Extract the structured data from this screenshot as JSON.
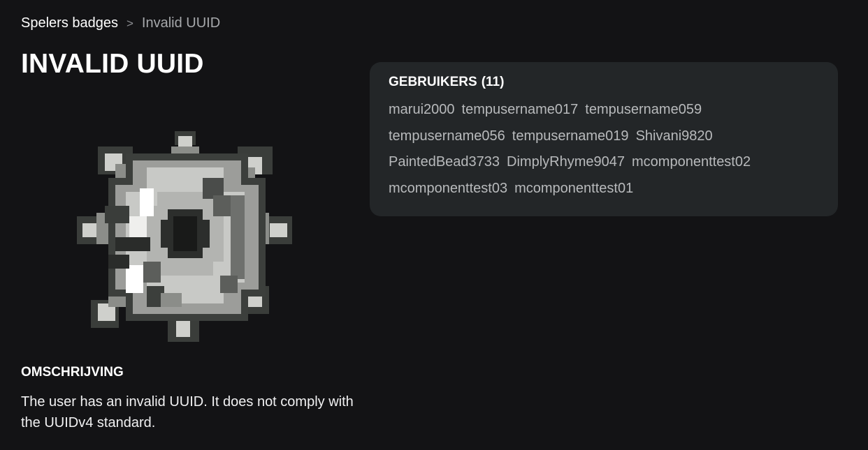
{
  "breadcrumb": {
    "parent": "Spelers badges",
    "separator": ">",
    "current": "Invalid UUID"
  },
  "page": {
    "title": "INVALID UUID"
  },
  "badge": {
    "icon": "spiked-mine-broken-icon"
  },
  "description": {
    "heading": "OMSCHRIJVING",
    "text": "The user has an invalid UUID. It does not comply with the UUIDv4 standard."
  },
  "users": {
    "heading": "GEBRUIKERS",
    "count": "(11)",
    "items": [
      "marui2000",
      "tempusername017",
      "tempusername059",
      "tempusername056",
      "tempusername019",
      "Shivani9820",
      "PaintedBead3733",
      "DimplyRhyme9047",
      "mcomponenttest02",
      "mcomponenttest03",
      "mcomponenttest01"
    ]
  },
  "colors": {
    "background": "#131315",
    "card": "#232628",
    "text": "#ffffff",
    "muted": "#b8babc"
  }
}
